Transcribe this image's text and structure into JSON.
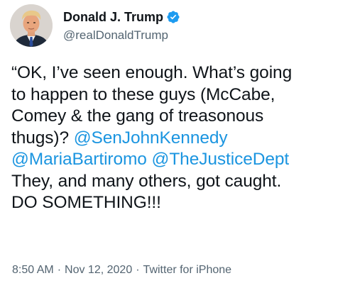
{
  "author": {
    "display_name": "Donald J. Trump",
    "handle": "@realDonaldTrump",
    "verified": true,
    "avatar_icon": "profile-photo-avatar"
  },
  "tweet": {
    "lines": [
      {
        "segments": [
          {
            "text": "“OK, I’ve seen enough. What’s going",
            "type": "text"
          }
        ]
      },
      {
        "segments": [
          {
            "text": "to happen to these guys (McCabe,",
            "type": "text"
          }
        ]
      },
      {
        "segments": [
          {
            "text": "Comey & the gang of treasonous",
            "type": "text"
          }
        ]
      },
      {
        "segments": [
          {
            "text": "thugs)? ",
            "type": "text"
          },
          {
            "text": "@SenJohnKennedy",
            "type": "mention"
          }
        ]
      },
      {
        "segments": [
          {
            "text": "@MariaBartiromo",
            "type": "mention"
          },
          {
            "text": " ",
            "type": "text"
          },
          {
            "text": "@TheJusticeDept",
            "type": "mention"
          }
        ]
      },
      {
        "segments": [
          {
            "text": "They, and many others, got caught.",
            "type": "text"
          }
        ]
      },
      {
        "segments": [
          {
            "text": "DO SOMETHING!!!",
            "type": "text"
          }
        ]
      }
    ]
  },
  "meta": {
    "time": "8:50 AM",
    "date": "Nov 12, 2020",
    "source": "Twitter for iPhone",
    "separator": "·"
  },
  "colors": {
    "text": "#0f1419",
    "secondary": "#536471",
    "mention": "#1b95e0",
    "verified": "#1d9bf0"
  }
}
